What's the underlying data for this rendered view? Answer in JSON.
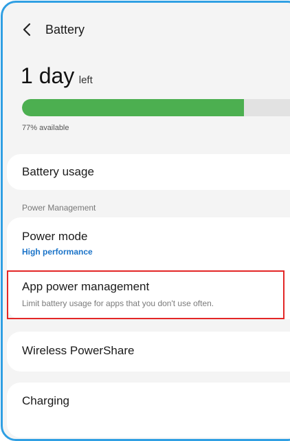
{
  "header": {
    "title": "Battery",
    "back_icon": "chevron-left-icon"
  },
  "summary": {
    "time_value": "1 day",
    "time_suffix": "left",
    "available_text": "77% available",
    "battery_level_percent": 77,
    "bar_color": "#4caf50"
  },
  "items": {
    "battery_usage": "Battery usage",
    "section_power_management": "Power Management",
    "power_mode": {
      "label": "Power mode",
      "value": "High performance",
      "value_color": "#1a73c8"
    },
    "app_power_management": {
      "label": "App power management",
      "description": "Limit battery usage for apps that you don't use often."
    },
    "wireless_powershare": "Wireless PowerShare",
    "charging": "Charging"
  },
  "colors": {
    "frame_border": "#2f9fe3",
    "highlight_border": "#e32626"
  }
}
